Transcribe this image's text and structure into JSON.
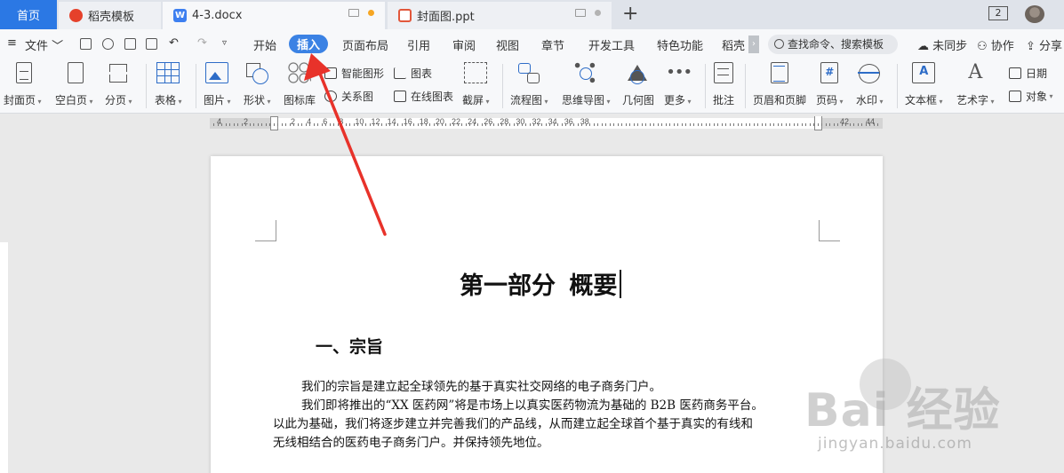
{
  "tabs": {
    "home": "首页",
    "template": "稻壳模板",
    "doc": "4-3.docx",
    "ppt": "封面图.ppt",
    "add": "+",
    "window_count": "2"
  },
  "menubar": {
    "file": "文件",
    "items": [
      "开始",
      "插入",
      "页面布局",
      "引用",
      "审阅",
      "视图",
      "章节",
      "开发工具",
      "特色功能",
      "稻壳"
    ],
    "active": "插入",
    "search_placeholder": "查找命令、搜索模板",
    "unsynced": "未同步",
    "collab": "协作",
    "share": "分享",
    "scroll_arrow": "›"
  },
  "ribbon": {
    "cover": "封面页",
    "blank": "空白页",
    "pagebreak": "分页",
    "table": "表格",
    "picture": "图片",
    "shape": "形状",
    "iconlib": "图标库",
    "smartart": "智能图形",
    "relation": "关系图",
    "chart": "图表",
    "online_chart": "在线图表",
    "screenshot": "截屏",
    "flowchart": "流程图",
    "mindmap": "思维导图",
    "geometry": "几何图",
    "more": "更多",
    "comment": "批注",
    "header_footer": "页眉和页脚",
    "page_number": "页码",
    "watermark": "水印",
    "textbox": "文本框",
    "wordart": "艺术字",
    "date": "日期",
    "object": "对象"
  },
  "ruler": {
    "labels": [
      "4",
      "2",
      "2",
      "4",
      "6",
      "8",
      "10",
      "12",
      "14",
      "16",
      "18",
      "20",
      "22",
      "24",
      "26",
      "28",
      "30",
      "32",
      "34",
      "36",
      "38",
      "42",
      "44"
    ]
  },
  "document": {
    "title": "第一部分  概要",
    "heading": "一、宗旨",
    "paragraph_lines": [
      "我们的宗旨是建立起全球领先的基于真实社交网络的电子商务门户。",
      "我们即将推出的“XX 医药网”将是市场上以真实医药物流为基础的 B2B 医药商务平台。",
      "以此为基础，我们将逐步建立并完善我们的产品线，从而建立起全球首个基于真实的有线和",
      "无线相结合的医药电子商务门户。并保持领先地位。"
    ]
  },
  "watermark": {
    "logo": "Bai  经验",
    "sub": "jingyan.baidu.com"
  },
  "colors": {
    "accent": "#3b82e4",
    "home_tab": "#2b78e4",
    "arrow": "#e8322a",
    "icon_blue": "#2d6cc7"
  }
}
